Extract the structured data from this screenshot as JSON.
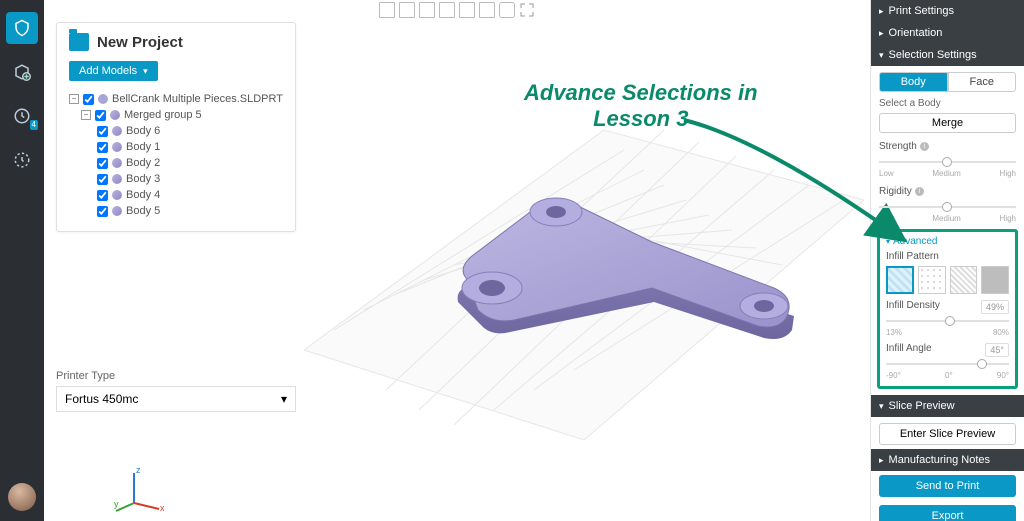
{
  "project": {
    "title": "New Project",
    "add_models": "Add Models"
  },
  "tree": {
    "file": "BellCrank Multiple Pieces.SLDPRT",
    "group": "Merged group 5",
    "bodies": [
      "Body 6",
      "Body 1",
      "Body 2",
      "Body 3",
      "Body 4",
      "Body 5"
    ]
  },
  "printer": {
    "label": "Printer Type",
    "selected": "Fortus 450mc"
  },
  "toolbar": {
    "queue_badge": "4"
  },
  "annotation": {
    "line1": "Advance Selections in",
    "line2": "Lesson 3"
  },
  "right": {
    "print_settings": "Print Settings",
    "orientation": "Orientation",
    "selection_settings": "Selection Settings",
    "body": "Body",
    "face": "Face",
    "select_a_body": "Select a Body",
    "merge": "Merge",
    "strength": "Strength",
    "rigidity": "Rigidity",
    "advanced": "Advanced",
    "infill_pattern": "Infill Pattern",
    "infill_density": "Infill Density",
    "infill_density_val": "49%",
    "infill_density_min": "13%",
    "infill_density_max": "80%",
    "infill_angle": "Infill Angle",
    "infill_angle_val": "45°",
    "infill_angle_min": "-90°",
    "infill_angle_mid": "0°",
    "infill_angle_max": "90°",
    "low": "Low",
    "medium": "Medium",
    "high": "High",
    "slice_preview": "Slice Preview",
    "enter_slice": "Enter Slice Preview",
    "manuf_notes": "Manufacturing Notes",
    "send_to_print": "Send to Print",
    "export": "Export"
  }
}
